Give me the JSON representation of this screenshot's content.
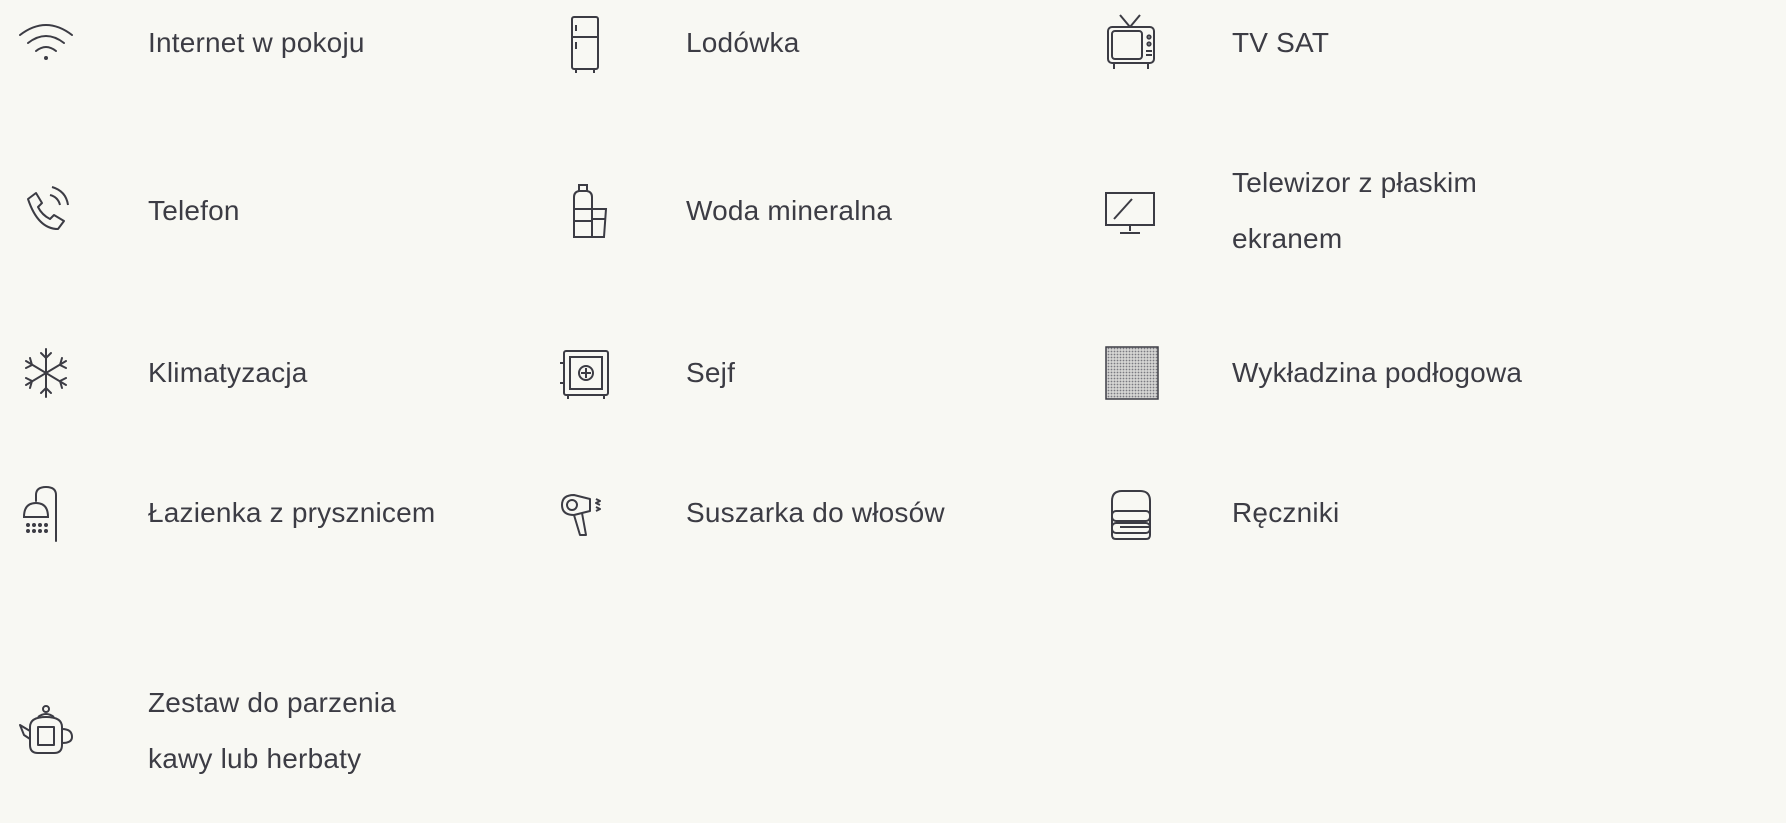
{
  "amenities": [
    {
      "label": "Internet w pokoju",
      "icon": "wifi-icon"
    },
    {
      "label": "Lodówka",
      "icon": "fridge-icon"
    },
    {
      "label": "TV SAT",
      "icon": "tv-icon"
    },
    {
      "label": "Telefon",
      "icon": "phone-icon"
    },
    {
      "label": "Woda mineralna",
      "icon": "water-bottle-icon"
    },
    {
      "label": "Telewizor z płaskim ekranem",
      "icon": "flat-screen-tv-icon"
    },
    {
      "label": "Klimatyzacja",
      "icon": "snowflake-icon"
    },
    {
      "label": "Sejf",
      "icon": "safe-icon"
    },
    {
      "label": "Wykładzina podłogowa",
      "icon": "carpet-icon"
    },
    {
      "label": "Łazienka z prysznicem",
      "icon": "shower-icon"
    },
    {
      "label": "Suszarka do włosów",
      "icon": "hair-dryer-icon"
    },
    {
      "label": "Ręczniki",
      "icon": "towels-icon"
    },
    {
      "label": "Zestaw do parzenia kawy lub herbaty",
      "icon": "kettle-icon"
    }
  ]
}
